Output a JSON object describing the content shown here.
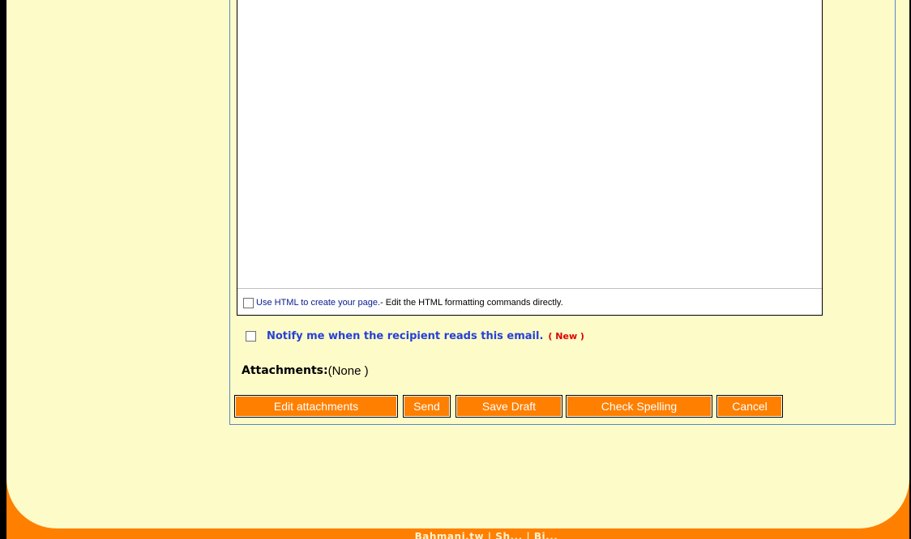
{
  "editor": {
    "body_text": "",
    "html_toggle": {
      "link_label": "Use HTML to create your page.",
      "description": " - Edit the HTML formatting commands directly."
    }
  },
  "notify": {
    "label": "Notify me when the recipient reads this email.",
    "badge": "( New )"
  },
  "attachments": {
    "label": "Attachments:",
    "value": "(None )"
  },
  "buttons": {
    "edit_attachments": "Edit attachments",
    "send": "Send",
    "save_draft": "Save Draft",
    "check_spelling": "Check Spelling",
    "cancel": "Cancel"
  },
  "footer": {
    "text": "Bahmani.tw  |  Sh...  |  Bi..."
  },
  "colors": {
    "accent": "#ff7f00",
    "panel": "#fdfbc8",
    "link": "#0a1b8e",
    "notify": "#2541d6",
    "badge": "#e00000"
  }
}
